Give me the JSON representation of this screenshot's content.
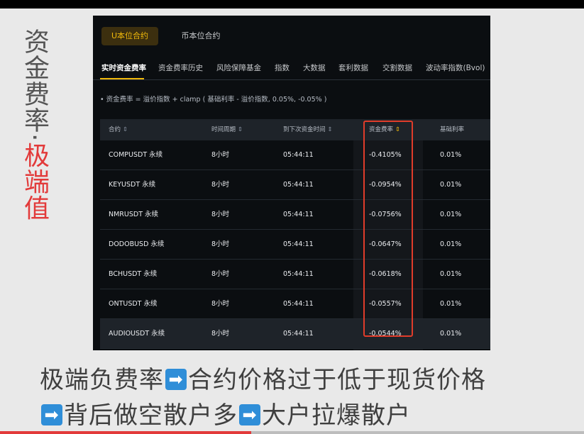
{
  "side_title": {
    "main": "资金费率·",
    "accent": "极端值"
  },
  "segments": {
    "active": "U本位合约",
    "inactive": "币本位合约"
  },
  "tabs": [
    "实时资金费率",
    "资金费率历史",
    "风险保障基金",
    "指数",
    "大数据",
    "套利数据",
    "交割数据",
    "波动率指数(Bvol)"
  ],
  "formula": "• 资金费率 = 溢价指数 + clamp ( 基础利率 - 溢价指数, 0.05%, -0.05% )",
  "table": {
    "headers": [
      "合约",
      "时间周期",
      "到下次资金时间",
      "资金费率",
      "基础利率"
    ],
    "sort_icon": "⇕",
    "rows": [
      [
        "COMPUSDT 永续",
        "8小时",
        "05:44:11",
        "-0.4105%",
        "0.01%"
      ],
      [
        "KEYUSDT 永续",
        "8小时",
        "05:44:11",
        "-0.0954%",
        "0.01%"
      ],
      [
        "NMRUSDT 永续",
        "8小时",
        "05:44:11",
        "-0.0756%",
        "0.01%"
      ],
      [
        "DODOBUSD 永续",
        "8小时",
        "05:44:11",
        "-0.0647%",
        "0.01%"
      ],
      [
        "BCHUSDT 永续",
        "8小时",
        "05:44:11",
        "-0.0618%",
        "0.01%"
      ],
      [
        "ONTUSDT 永续",
        "8小时",
        "05:44:11",
        "-0.0557%",
        "0.01%"
      ],
      [
        "AUDIOUSDT 永续",
        "8小时",
        "05:44:11",
        "-0.0544%",
        "0.01%"
      ]
    ]
  },
  "caption": {
    "line1": [
      "极端负费率",
      "合约价格过于低于现货价格"
    ],
    "line2": [
      "背后做空散户多",
      "大户拉爆散户"
    ],
    "arrow_icon": "➡"
  },
  "progress": {
    "played_fraction": 0.43
  },
  "colors": {
    "accent": "#f0b90b",
    "highlight_box": "#e03c2a",
    "title_red": "#e23a3a"
  }
}
